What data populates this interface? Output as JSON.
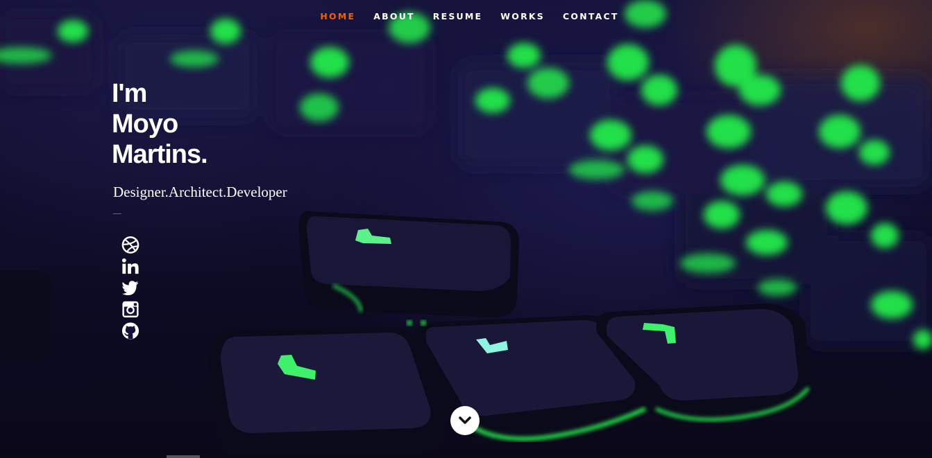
{
  "nav": {
    "items": [
      {
        "label": "HOME",
        "active": true
      },
      {
        "label": "ABOUT",
        "active": false
      },
      {
        "label": "RESUME",
        "active": false
      },
      {
        "label": "WORKS",
        "active": false
      },
      {
        "label": "CONTACT",
        "active": false
      }
    ],
    "active_color": "#f06000"
  },
  "intro": {
    "line1": "I'm",
    "line2": "Moyo",
    "line3": "Martins.",
    "tagline": "Designer.Architect.Developer"
  },
  "social_icons": [
    "dribbble-icon",
    "linkedin-icon",
    "twitter-icon",
    "instagram-icon",
    "github-icon"
  ],
  "scroll_icon": "chevron-down-icon",
  "colors": {
    "accent": "#f06000",
    "key_glow": "#22e04a",
    "background": "#14123a"
  }
}
